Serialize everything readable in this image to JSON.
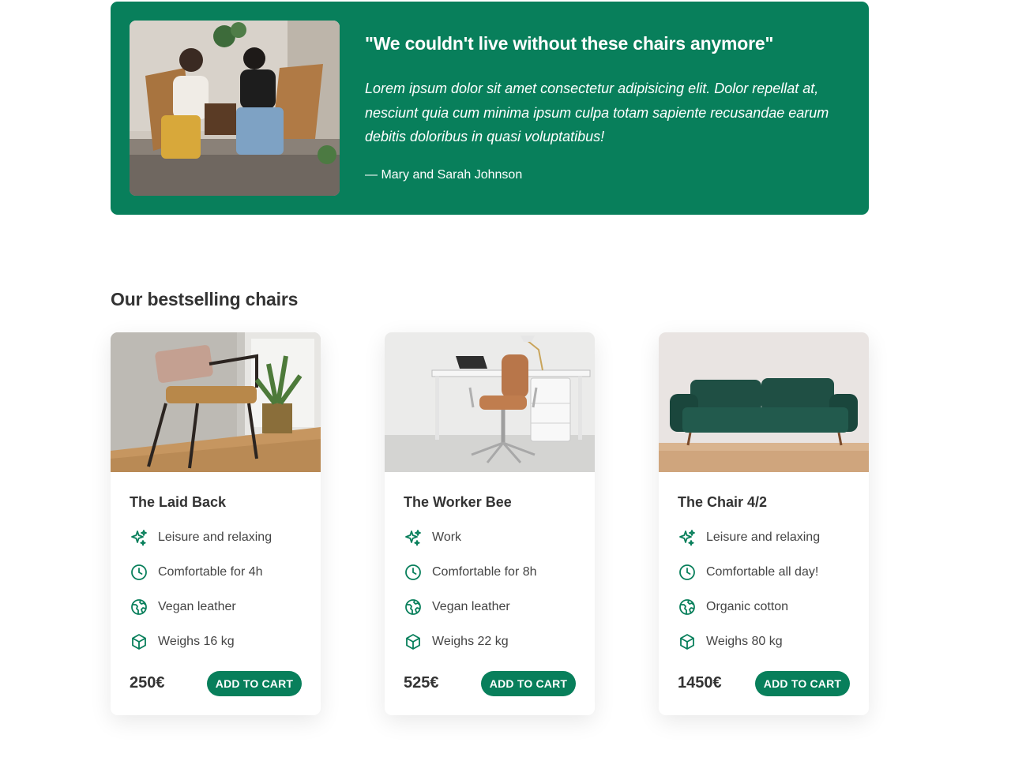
{
  "testimonial": {
    "quote": "\"We couldn't live without these chairs anymore\"",
    "text": "Lorem ipsum dolor sit amet consectetur adipisicing elit. Dolor repellat at, nesciunt quia cum minima ipsum culpa totam sapiente recusandae earum debitis doloribus in quasi voluptatibus!",
    "author": "— Mary and Sarah Johnson"
  },
  "section": {
    "title": "Our bestselling chairs"
  },
  "colors": {
    "accent": "#087f5b",
    "text": "#333333"
  },
  "products": [
    {
      "title": "The Laid Back",
      "attributes": [
        {
          "icon": "sparkles-icon",
          "label": "Leisure and relaxing"
        },
        {
          "icon": "clock-icon",
          "label": "Comfortable for 4h"
        },
        {
          "icon": "globe-icon",
          "label": "Vegan leather"
        },
        {
          "icon": "cube-icon",
          "label": "Weighs 16 kg"
        }
      ],
      "price": "250€",
      "button": "ADD TO CART"
    },
    {
      "title": "The Worker Bee",
      "attributes": [
        {
          "icon": "sparkles-icon",
          "label": "Work"
        },
        {
          "icon": "clock-icon",
          "label": "Comfortable for 8h"
        },
        {
          "icon": "globe-icon",
          "label": "Vegan leather"
        },
        {
          "icon": "cube-icon",
          "label": "Weighs 22 kg"
        }
      ],
      "price": "525€",
      "button": "ADD TO CART"
    },
    {
      "title": "The Chair 4/2",
      "attributes": [
        {
          "icon": "sparkles-icon",
          "label": "Leisure and relaxing"
        },
        {
          "icon": "clock-icon",
          "label": "Comfortable all day!"
        },
        {
          "icon": "globe-icon",
          "label": "Organic cotton"
        },
        {
          "icon": "cube-icon",
          "label": "Weighs 80 kg"
        }
      ],
      "price": "1450€",
      "button": "ADD TO CART"
    }
  ]
}
